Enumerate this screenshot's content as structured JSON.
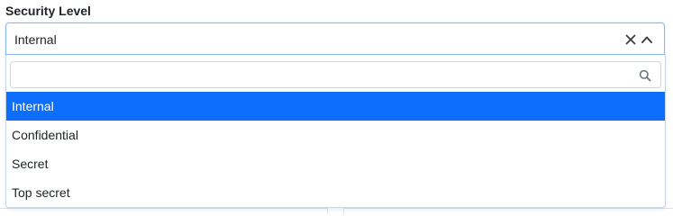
{
  "field": {
    "label": "Security Level",
    "selected_value": "Internal"
  },
  "search": {
    "value": "",
    "placeholder": ""
  },
  "options": [
    {
      "label": "Internal",
      "selected": true
    },
    {
      "label": "Confidential",
      "selected": false
    },
    {
      "label": "Secret",
      "selected": false
    },
    {
      "label": "Top secret",
      "selected": false
    }
  ],
  "icons": {
    "clear": "close-icon",
    "toggle": "chevron-up-icon",
    "search": "search-icon"
  },
  "colors": {
    "accent": "#0d6efd",
    "focus_border": "#86b7fe",
    "text": "#212529",
    "muted_icon": "#6c757d"
  }
}
